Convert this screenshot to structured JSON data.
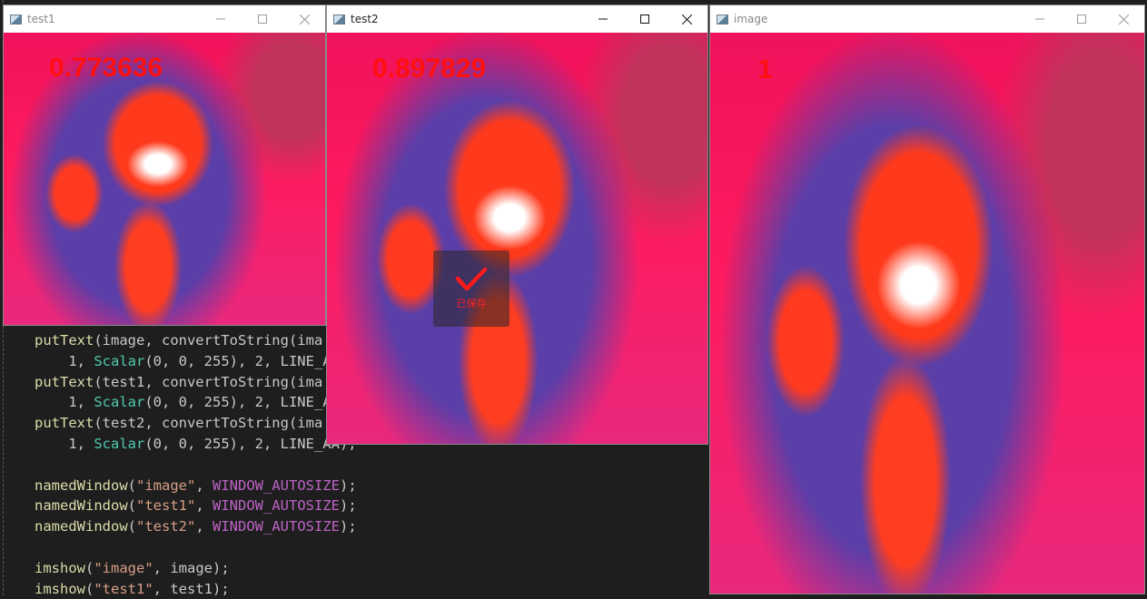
{
  "editor": {
    "lines": [
      {
        "parts": [
          [
            "fn",
            "putText"
          ],
          [
            "id",
            "(image, convertToString(ima"
          ]
        ]
      },
      {
        "parts": [
          [
            "id",
            "    1, "
          ],
          [
            "ty",
            "Scalar"
          ],
          [
            "id",
            "(0, 0, 255), 2, LINE_A"
          ]
        ]
      },
      {
        "parts": [
          [
            "fn",
            "putText"
          ],
          [
            "id",
            "(test1, convertToString(ima"
          ]
        ]
      },
      {
        "parts": [
          [
            "id",
            "    1, "
          ],
          [
            "ty",
            "Scalar"
          ],
          [
            "id",
            "(0, 0, 255), 2, LINE_A"
          ]
        ]
      },
      {
        "parts": [
          [
            "fn",
            "putText"
          ],
          [
            "id",
            "(test2, convertToString(ima"
          ]
        ]
      },
      {
        "parts": [
          [
            "id",
            "    1, "
          ],
          [
            "ty",
            "Scalar"
          ],
          [
            "id",
            "(0, 0, 255), 2, LINE_AA);"
          ]
        ]
      },
      {
        "parts": [
          [
            "id",
            ""
          ]
        ]
      },
      {
        "parts": [
          [
            "fn",
            "namedWindow"
          ],
          [
            "id",
            "("
          ],
          [
            "st",
            "\"image\""
          ],
          [
            "id",
            ", "
          ],
          [
            "mc",
            "WINDOW_AUTOSIZE"
          ],
          [
            "id",
            ");"
          ]
        ]
      },
      {
        "parts": [
          [
            "fn",
            "namedWindow"
          ],
          [
            "id",
            "("
          ],
          [
            "st",
            "\"test1\""
          ],
          [
            "id",
            ", "
          ],
          [
            "mc",
            "WINDOW_AUTOSIZE"
          ],
          [
            "id",
            ");"
          ]
        ]
      },
      {
        "parts": [
          [
            "fn",
            "namedWindow"
          ],
          [
            "id",
            "("
          ],
          [
            "st",
            "\"test2\""
          ],
          [
            "id",
            ", "
          ],
          [
            "mc",
            "WINDOW_AUTOSIZE"
          ],
          [
            "id",
            ");"
          ]
        ]
      },
      {
        "parts": [
          [
            "id",
            ""
          ]
        ]
      },
      {
        "parts": [
          [
            "fn",
            "imshow"
          ],
          [
            "id",
            "("
          ],
          [
            "st",
            "\"image\""
          ],
          [
            "id",
            ", image);"
          ]
        ]
      },
      {
        "parts": [
          [
            "fn",
            "imshow"
          ],
          [
            "id",
            "("
          ],
          [
            "st",
            "\"test1\""
          ],
          [
            "id",
            ", test1);"
          ]
        ]
      }
    ]
  },
  "windows": {
    "test1": {
      "title": "test1",
      "score": "0.773636"
    },
    "test2": {
      "title": "test2",
      "score": "0.897829",
      "toast": "已保存"
    },
    "image": {
      "title": "image",
      "score": "1"
    }
  },
  "colors": {
    "score": "#ff1010",
    "titlebar": "#ffffff",
    "editor_bg": "#1e1e1e"
  },
  "icons": {
    "minimize": "minimize-icon",
    "maximize": "maximize-icon",
    "close": "close-icon",
    "app": "opencv-window-icon",
    "toast": "checkmark-icon"
  }
}
